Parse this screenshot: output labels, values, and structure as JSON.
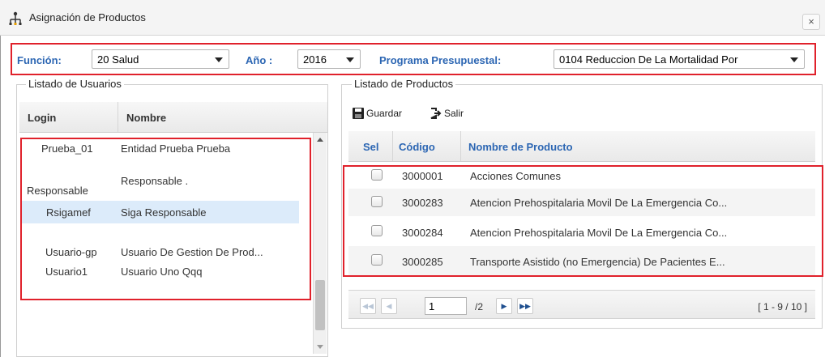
{
  "window": {
    "title": "Asignación de Productos",
    "close_label": "×"
  },
  "filters": {
    "funcion_label": "Función:",
    "funcion_value": "20 Salud",
    "anio_label": "Año :",
    "anio_value": "2016",
    "programa_label": "Programa Presupuestal:",
    "programa_value": "0104 Reduccion De La Mortalidad Por"
  },
  "usuarios": {
    "legend": "Listado de Usuarios",
    "columns": {
      "login": "Login",
      "nombre": "Nombre"
    },
    "rows": [
      {
        "login": "Prueba_01",
        "nombre": "Entidad Prueba Prueba"
      },
      {
        "login": "Responsable",
        "nombre": "Responsable ."
      },
      {
        "login": "Rsigamef",
        "nombre": "Siga Responsable"
      },
      {
        "login": "Usuario-gp",
        "nombre": "Usuario De Gestion De Prod..."
      },
      {
        "login": "Usuario1",
        "nombre": "Usuario Uno Qqq"
      }
    ]
  },
  "productos": {
    "legend": "Listado de Productos",
    "toolbar": {
      "guardar": "Guardar",
      "salir": "Salir"
    },
    "columns": {
      "sel": "Sel",
      "codigo": "Código",
      "nombre": "Nombre de Producto"
    },
    "rows": [
      {
        "codigo": "3000001",
        "nombre": "Acciones Comunes"
      },
      {
        "codigo": "3000283",
        "nombre": "Atencion Prehospitalaria Movil De La Emergencia Co..."
      },
      {
        "codigo": "3000284",
        "nombre": "Atencion Prehospitalaria Movil De La Emergencia Co..."
      },
      {
        "codigo": "3000285",
        "nombre": "Transporte Asistido (no Emergencia) De Pacientes E..."
      }
    ],
    "pager": {
      "page": "1",
      "total": "/2",
      "range": "[ 1 - 9 / 10 ]"
    }
  },
  "colors": {
    "highlight_box": "#e0212b",
    "label_blue": "#2c66b3",
    "selected_row": "#dcebfa"
  }
}
